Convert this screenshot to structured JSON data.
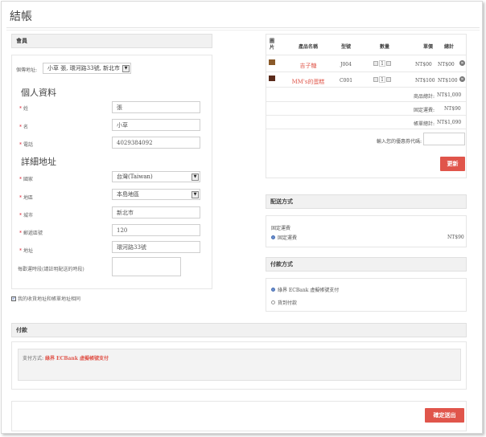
{
  "page": {
    "title": "結帳"
  },
  "member": {
    "header": "會員",
    "saved_address_label": "個傳地址:",
    "saved_address_value": "小草 張, 環河路33號, 新北市"
  },
  "personal": {
    "heading": "個人資料",
    "fields": [
      {
        "label": "姓",
        "value": "張"
      },
      {
        "label": "名",
        "value": "小草"
      },
      {
        "label": "電話",
        "value": "4029384092"
      }
    ]
  },
  "address": {
    "heading": "詳細地址",
    "country_label": "國家",
    "country_value": "台灣(Taiwan)",
    "region_label": "地區",
    "region_value": "本島地區",
    "city_label": "城市",
    "city_value": "新北市",
    "zip_label": "郵遞區號",
    "zip_value": "120",
    "street_label": "地址",
    "street_value": "環河路33號",
    "note_label": "每歡運時段(請註明配送的時段)",
    "same_address_label": "我的收貨地址和帳單地址相同"
  },
  "cart": {
    "columns": [
      "圖片",
      "產品名稱",
      "型號",
      "數量",
      "單價",
      "總計"
    ],
    "items": [
      {
        "name": "吉子糖",
        "model": "J004",
        "qty": "1",
        "price": "NT$00",
        "total": "NT$00"
      },
      {
        "name": "MM's的蛋糕",
        "model": "C001",
        "qty": "1",
        "price": "NT$100",
        "total": "NT$100"
      }
    ],
    "subtotal_label": "商品總計:",
    "subtotal_value": "NT$1,000",
    "shipping_label": "固定運費:",
    "shipping_value": "NT$90",
    "grand_label": "帳單總計:",
    "grand_value": "NT$1,090",
    "coupon_label": "輸入您的優惠券代碼:",
    "update_button": "更新"
  },
  "shipping_method": {
    "header": "配送方式",
    "group": "固定運費",
    "option": "固定運費",
    "price": "NT$90"
  },
  "payment_method": {
    "header": "付款方式",
    "options": [
      "綠界 ECBank 虛擬帳號支付",
      "貨到付款"
    ]
  },
  "payment": {
    "header": "付款",
    "info_label": "支付方式:",
    "info_value": "綠界 ECBank 虛擬帳號支付"
  },
  "confirm": {
    "button": "確定送出"
  },
  "colors": {
    "accent": "#e0554b",
    "link": "#e05a4e"
  }
}
